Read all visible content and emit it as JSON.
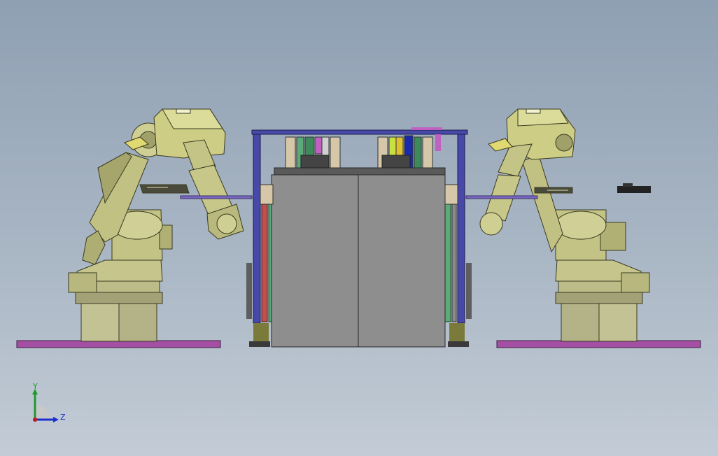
{
  "viewport": {
    "background_top": "#8fa0b3",
    "background_bottom": "#c3ccd6"
  },
  "scene": {
    "objects": [
      "robot-arm-left",
      "robot-arm-right",
      "fixture-station",
      "floor-plate-left",
      "floor-plate-right"
    ],
    "colors": {
      "robot_body": "#c9c98a",
      "robot_shadow": "#8f8f5a",
      "robot_outline": "#3a3a22",
      "floor_plate": "#a44fa4",
      "cabinet": "#8c8c8c",
      "frame_blue": "#4848a8",
      "frame_red": "#c05050",
      "frame_green": "#5caa78"
    }
  },
  "triad": {
    "y_label": "Y",
    "z_label": "Z",
    "y_color": "#1f9a2a",
    "z_color": "#1c2fd0",
    "origin_color": "#c01818"
  }
}
